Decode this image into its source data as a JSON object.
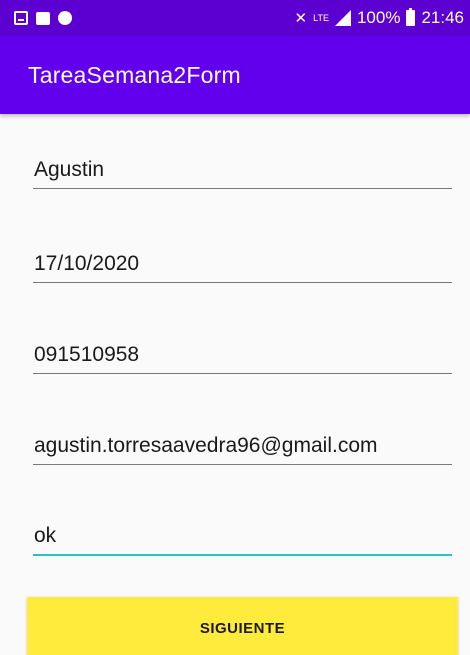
{
  "status_bar": {
    "battery": "100%",
    "time": "21:46",
    "network": "LTE",
    "icons": [
      "screenshot-icon",
      "store-icon",
      "sync-icon",
      "mute-icon",
      "signal-icon",
      "battery-icon"
    ]
  },
  "app_bar": {
    "title": "TareaSemana2Form",
    "color": "#6200ee"
  },
  "form": {
    "fields": [
      {
        "value": "Agustin"
      },
      {
        "value": "17/10/2020"
      },
      {
        "value": "091510958"
      },
      {
        "value": "agustin.torresaavedra96@gmail.com"
      },
      {
        "value": "ok",
        "focused": true
      }
    ],
    "accent_color": "#26c6c6"
  },
  "button": {
    "label": "SIGUIENTE",
    "color": "#ffeb3b"
  }
}
